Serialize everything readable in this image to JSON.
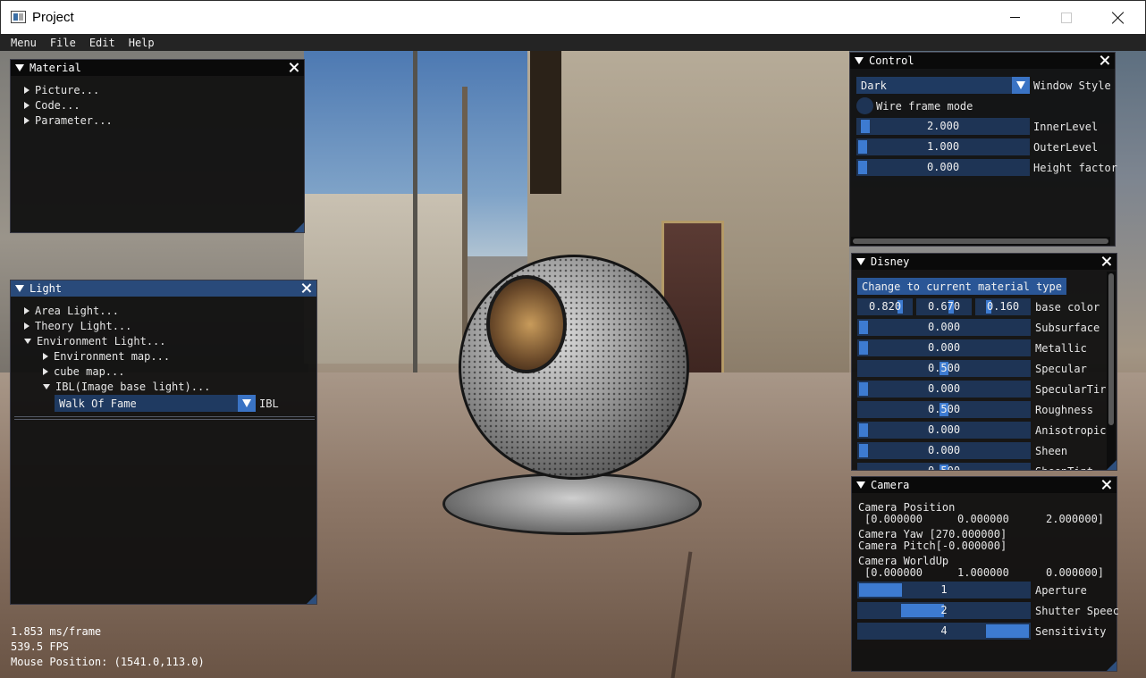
{
  "window": {
    "title": "Project"
  },
  "menubar": {
    "items": [
      "Menu",
      "File",
      "Edit",
      "Help"
    ]
  },
  "material": {
    "title": "Material",
    "items": [
      "Picture...",
      "Code...",
      "Parameter..."
    ]
  },
  "light": {
    "title": "Light",
    "items": [
      "Area Light...",
      "Theory Light...",
      "Environment Light..."
    ],
    "subitems": [
      "Environment map...",
      "cube map...",
      "IBL(Image base light)..."
    ],
    "ibl_combo": {
      "value": "Walk Of Fame",
      "label": "IBL"
    }
  },
  "control": {
    "title": "Control",
    "style_combo": {
      "value": "Dark",
      "label": "Window Style"
    },
    "wireframe_label": "Wire frame mode",
    "sliders": [
      {
        "value": "2.000",
        "label": "InnerLevel",
        "fraction": 0.0
      },
      {
        "value": "1.000",
        "label": "OuterLevel",
        "fraction": 0.0
      },
      {
        "value": "0.000",
        "label": "Height factor",
        "fraction": 0.0
      }
    ]
  },
  "disney": {
    "title": "Disney",
    "change_button": "Change to current material type",
    "base_color": {
      "r": "0.820",
      "g": "0.670",
      "b": "0.160",
      "label": "base color"
    },
    "params": [
      {
        "value": "0.000",
        "label": "Subsurface",
        "fraction": 0.0
      },
      {
        "value": "0.000",
        "label": "Metallic",
        "fraction": 0.0
      },
      {
        "value": "0.500",
        "label": "Specular",
        "fraction": 0.5
      },
      {
        "value": "0.000",
        "label": "SpecularTir",
        "fraction": 0.0
      },
      {
        "value": "0.500",
        "label": "Roughness",
        "fraction": 0.5
      },
      {
        "value": "0.000",
        "label": "Anisotropic",
        "fraction": 0.0
      },
      {
        "value": "0.000",
        "label": "Sheen",
        "fraction": 0.0
      },
      {
        "value": "0.500",
        "label": "SheenTint",
        "fraction": 0.5
      }
    ]
  },
  "camera": {
    "title": "Camera",
    "position_label": "Camera Position",
    "position_values": [
      "[0.000000",
      "0.000000",
      "2.000000]"
    ],
    "yaw": "Camera Yaw [270.000000]",
    "pitch": "Camera Pitch[-0.000000]",
    "worldup_label": "Camera WorldUp",
    "worldup_values": [
      "[0.000000",
      "1.000000",
      "0.000000]"
    ],
    "sliders": [
      {
        "value": "1",
        "label": "Aperture",
        "fraction": 0.0
      },
      {
        "value": "2",
        "label": "Shutter Speec",
        "fraction": 0.33
      },
      {
        "value": "4",
        "label": "Sensitivity",
        "fraction": 1.0
      }
    ]
  },
  "stats": {
    "frame_time": "1.853 ms/frame",
    "fps": "539.5 FPS",
    "mouse": "Mouse Position: (1541.0,113.0)"
  },
  "colors": {
    "panel_bg": "#0f0f0f",
    "header_active": "#294a7a",
    "widget_bg": "#1e3455",
    "accent": "#3d7bd1"
  }
}
